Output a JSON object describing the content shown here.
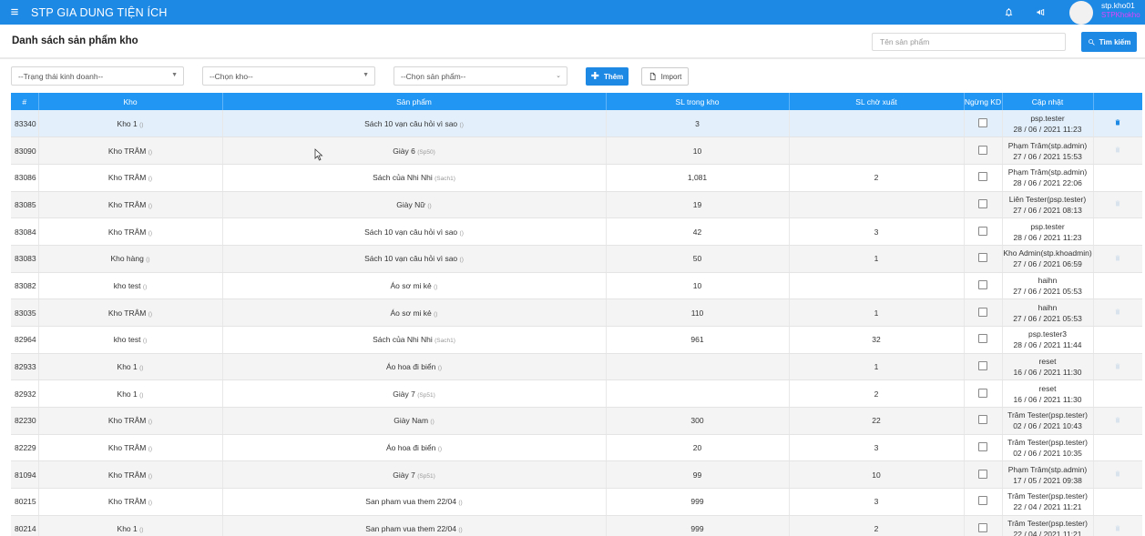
{
  "app": {
    "title": "STP GIA DUNG TIỆN ÍCH",
    "user_name": "stp.kho01",
    "user_role": "STPKhokho"
  },
  "page": {
    "title": "Danh sách sản phẩm kho",
    "search_placeholder": "Tên sản phẩm",
    "search_button": "Tìm kiếm"
  },
  "filters": {
    "status": "--Trạng thái kinh doanh--",
    "warehouse": "--Chọn kho--",
    "product": "--Chọn sản phẩm--",
    "add_button": "Thêm",
    "import_button": "Import"
  },
  "table": {
    "headers": [
      "#",
      "Kho",
      "Sản phẩm",
      "SL trong kho",
      "SL chờ xuất",
      "Ngừng KD",
      "Cập nhật",
      ""
    ],
    "rows": [
      {
        "id": "83340",
        "kho": "Kho 1",
        "kho_code": "()",
        "product": "Sách 10 vạn câu hỏi vì sao",
        "code": "()",
        "qty": "3",
        "pending": "",
        "updater": "psp.tester",
        "date": "28 / 06 / 2021 11:23",
        "trash": "on"
      },
      {
        "id": "83090",
        "kho": "Kho TRÂM",
        "kho_code": "()",
        "product": "Giày 6",
        "code": "(Sp50)",
        "qty": "10",
        "pending": "",
        "updater": "Phạm Trâm(stp.admin)",
        "date": "27 / 06 / 2021 15:53",
        "trash": "faint"
      },
      {
        "id": "83086",
        "kho": "Kho TRÂM",
        "kho_code": "()",
        "product": "Sách của Nhi Nhi",
        "code": "(Sach1)",
        "qty": "1,081",
        "pending": "2",
        "updater": "Phạm Trâm(stp.admin)",
        "date": "28 / 06 / 2021 22:06",
        "trash": "none"
      },
      {
        "id": "83085",
        "kho": "Kho TRÂM",
        "kho_code": "()",
        "product": "Giày Nữ",
        "code": "()",
        "qty": "19",
        "pending": "",
        "updater": "Liên Tester(psp.tester)",
        "date": "27 / 06 / 2021 08:13",
        "trash": "faint"
      },
      {
        "id": "83084",
        "kho": "Kho TRÂM",
        "kho_code": "()",
        "product": "Sách 10 vạn câu hỏi vì sao",
        "code": "()",
        "qty": "42",
        "pending": "3",
        "updater": "psp.tester",
        "date": "28 / 06 / 2021 11:23",
        "trash": "none"
      },
      {
        "id": "83083",
        "kho": "Kho hàng",
        "kho_code": "()",
        "product": "Sách 10 vạn câu hỏi vì sao",
        "code": "()",
        "qty": "50",
        "pending": "1",
        "updater": "Kho Admin(stp.khoadmin)",
        "date": "27 / 06 / 2021 06:59",
        "trash": "faint"
      },
      {
        "id": "83082",
        "kho": "kho test",
        "kho_code": "()",
        "product": "Áo sơ mi kẻ",
        "code": "()",
        "qty": "10",
        "pending": "",
        "updater": "haihn",
        "date": "27 / 06 / 2021 05:53",
        "trash": "none"
      },
      {
        "id": "83035",
        "kho": "Kho TRÂM",
        "kho_code": "()",
        "product": "Áo sơ mi kẻ",
        "code": "()",
        "qty": "110",
        "pending": "1",
        "updater": "haihn",
        "date": "27 / 06 / 2021 05:53",
        "trash": "faint"
      },
      {
        "id": "82964",
        "kho": "kho test",
        "kho_code": "()",
        "product": "Sách của Nhi Nhi",
        "code": "(Sach1)",
        "qty": "961",
        "pending": "32",
        "updater": "psp.tester3",
        "date": "28 / 06 / 2021 11:44",
        "trash": "none"
      },
      {
        "id": "82933",
        "kho": "Kho 1",
        "kho_code": "()",
        "product": "Áo hoa đi biển",
        "code": "()",
        "qty": "",
        "pending": "1",
        "updater": "reset",
        "date": "16 / 06 / 2021 11:30",
        "trash": "faint"
      },
      {
        "id": "82932",
        "kho": "Kho 1",
        "kho_code": "()",
        "product": "Giày 7",
        "code": "(Sp51)",
        "qty": "",
        "pending": "2",
        "updater": "reset",
        "date": "16 / 06 / 2021 11:30",
        "trash": "none"
      },
      {
        "id": "82230",
        "kho": "Kho TRÂM",
        "kho_code": "()",
        "product": "Giày Nam",
        "code": "()",
        "qty": "300",
        "pending": "22",
        "updater": "Trâm Tester(psp.tester)",
        "date": "02 / 06 / 2021 10:43",
        "trash": "faint"
      },
      {
        "id": "82229",
        "kho": "Kho TRÂM",
        "kho_code": "()",
        "product": "Áo hoa đi biển",
        "code": "()",
        "qty": "20",
        "pending": "3",
        "updater": "Trâm Tester(psp.tester)",
        "date": "02 / 06 / 2021 10:35",
        "trash": "none"
      },
      {
        "id": "81094",
        "kho": "Kho TRÂM",
        "kho_code": "()",
        "product": "Giày 7",
        "code": "(Sp51)",
        "qty": "99",
        "pending": "10",
        "updater": "Phạm Trâm(stp.admin)",
        "date": "17 / 05 / 2021 09:38",
        "trash": "faint"
      },
      {
        "id": "80215",
        "kho": "Kho TRÂM",
        "kho_code": "()",
        "product": "San pham vua them 22/04",
        "code": "()",
        "qty": "999",
        "pending": "3",
        "updater": "Trâm Tester(psp.tester)",
        "date": "22 / 04 / 2021 11:21",
        "trash": "none"
      },
      {
        "id": "80214",
        "kho": "Kho 1",
        "kho_code": "()",
        "product": "San pham vua them 22/04",
        "code": "()",
        "qty": "999",
        "pending": "2",
        "updater": "Trâm Tester(psp.tester)",
        "date": "22 / 04 / 2021 11:21",
        "trash": "faint"
      }
    ]
  },
  "colors": {
    "primary": "#1e88e5",
    "header": "#2196f3",
    "role": "#e040fb"
  },
  "icons": [
    "menu-icon",
    "bell-icon",
    "megaphone-icon",
    "search-icon",
    "plus-icon",
    "file-icon",
    "trash-icon",
    "mouse-cursor-icon"
  ]
}
